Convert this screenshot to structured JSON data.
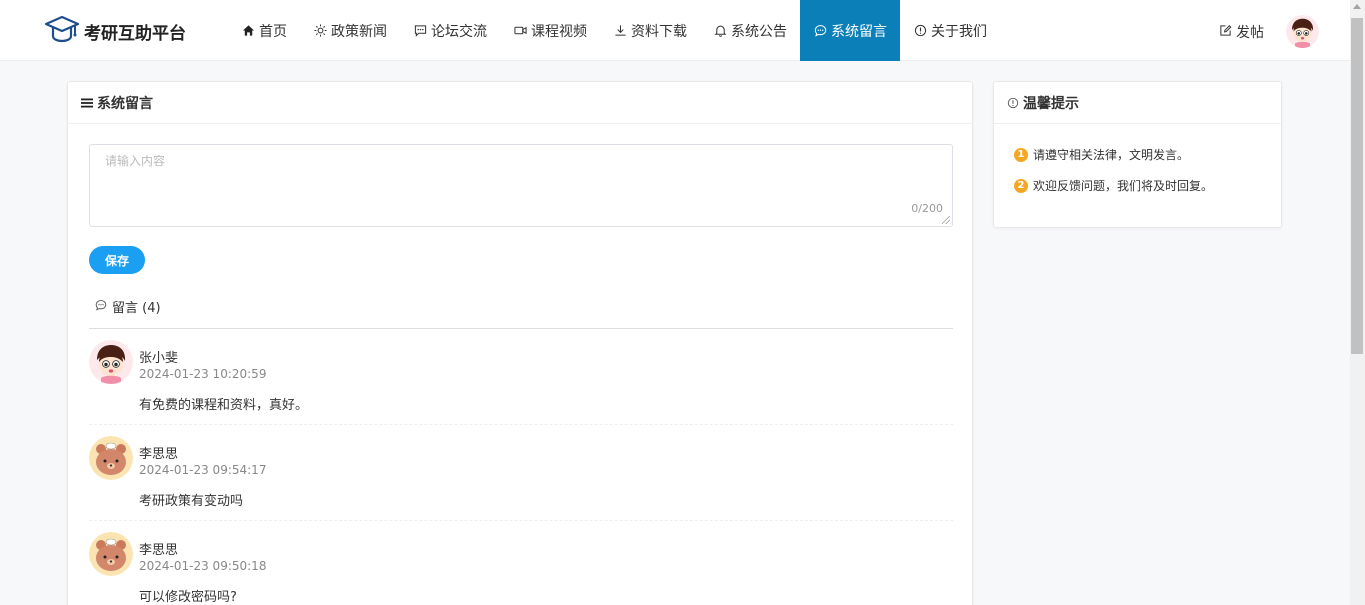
{
  "brand": {
    "name": "考研互助平台",
    "logo_icon": "graduation-cap-icon"
  },
  "nav": [
    {
      "label": "首页",
      "icon": "home-icon",
      "active": false
    },
    {
      "label": "政策新闻",
      "icon": "sun-icon",
      "active": false
    },
    {
      "label": "论坛交流",
      "icon": "chat-icon",
      "active": false
    },
    {
      "label": "课程视频",
      "icon": "video-icon",
      "active": false
    },
    {
      "label": "资料下载",
      "icon": "download-icon",
      "active": false
    },
    {
      "label": "系统公告",
      "icon": "bell-icon",
      "active": false
    },
    {
      "label": "系统留言",
      "icon": "message-icon",
      "active": true
    },
    {
      "label": "关于我们",
      "icon": "info-icon",
      "active": false
    }
  ],
  "header": {
    "post_label": "发帖"
  },
  "main": {
    "title": "系统留言",
    "textarea_placeholder": "请输入内容",
    "counter": "0/200",
    "save_label": "保存",
    "comments_title": "留言 (4)"
  },
  "comments": [
    {
      "name": "张小斐",
      "time": "2024-01-23 10:20:59",
      "content": "有免费的课程和资料，真好。",
      "avatar": "girl"
    },
    {
      "name": "李思思",
      "time": "2024-01-23 09:54:17",
      "content": "考研政策有变动吗",
      "avatar": "bear"
    },
    {
      "name": "李思思",
      "time": "2024-01-23 09:50:18",
      "content": "可以修改密码吗?",
      "avatar": "bear"
    }
  ],
  "side": {
    "title": "温馨提示",
    "tips": [
      {
        "num": "1",
        "text": "请遵守相关法律，文明发言。"
      },
      {
        "num": "2",
        "text": "欢迎反馈问题，我们将及时回复。"
      }
    ]
  },
  "colors": {
    "nav_active": "#0b7fb8",
    "save_button": "#1a9ff2",
    "tip_badge": "#f5a623"
  }
}
